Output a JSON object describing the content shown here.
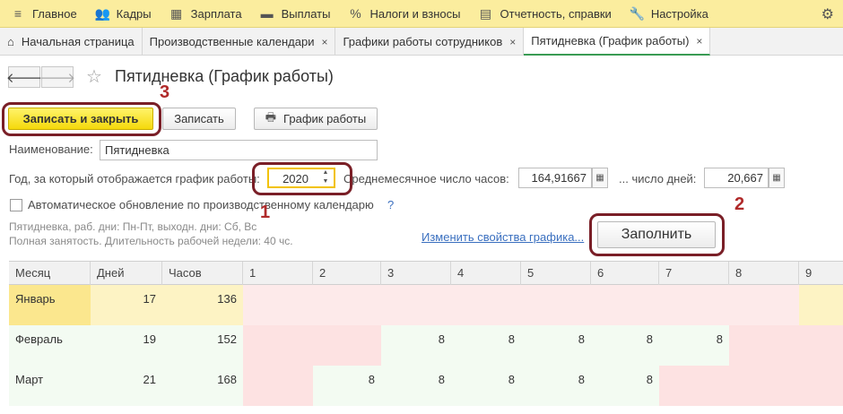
{
  "menu": [
    {
      "icon": "≡",
      "label": "Главное",
      "name": "menu-main"
    },
    {
      "icon": "👥",
      "label": "Кадры",
      "name": "menu-staff"
    },
    {
      "icon": "▦",
      "label": "Зарплата",
      "name": "menu-salary"
    },
    {
      "icon": "▬",
      "label": "Выплаты",
      "name": "menu-payments"
    },
    {
      "icon": "%",
      "label": "Налоги и взносы",
      "name": "menu-taxes"
    },
    {
      "icon": "▤",
      "label": "Отчетность, справки",
      "name": "menu-reports"
    },
    {
      "icon": "🔧",
      "label": "Настройка",
      "name": "menu-settings"
    }
  ],
  "tabs": [
    {
      "label": "Начальная страница",
      "home": true,
      "close": false,
      "active": false
    },
    {
      "label": "Производственные календари",
      "home": false,
      "close": true,
      "active": false
    },
    {
      "label": "Графики работы сотрудников",
      "home": false,
      "close": true,
      "active": false
    },
    {
      "label": "Пятидневка (График работы)",
      "home": false,
      "close": true,
      "active": true
    }
  ],
  "header": {
    "back": "🡐",
    "forward": "🡒",
    "title": "Пятидневка (График работы)"
  },
  "toolbar": {
    "save_close": "Записать и закрыть",
    "save": "Записать",
    "schedule": "График работы"
  },
  "form": {
    "name_label": "Наименование:",
    "name_value": "Пятидневка",
    "year_label": "Год, за который отображается график работы:",
    "year_value": "2020",
    "avg_hours_label": "Среднемесячное число часов:",
    "avg_hours_value": "164,91667",
    "days_label": "... число дней:",
    "days_value": "20,667",
    "auto_update_label": "Автоматическое обновление по производственному календарю",
    "help": "?",
    "info_line1": "Пятидневка, раб. дни: Пн-Пт, выходн. дни: Сб, Вс",
    "info_line2": "Полная занятость. Длительность рабочей недели: 40 чс.",
    "change_link": "Изменить свойства графика...",
    "fill_button": "Заполнить"
  },
  "annotations": {
    "a1": "1",
    "a2": "2",
    "a3": "3"
  },
  "colors": {
    "annotation_ring": "#7a1f27",
    "annotation_digit": "#b02a2a",
    "holiday": "#fde2e2",
    "workday": "#f3fbf2",
    "selected": "#fbe78e"
  },
  "grid": {
    "headers": [
      "Месяц",
      "Дней",
      "Часов",
      "1",
      "2",
      "3",
      "4",
      "5",
      "6",
      "7",
      "8",
      "9"
    ],
    "rows": [
      {
        "month": "Январь",
        "days": "17",
        "hours": "136",
        "cells": [
          "",
          "",
          "",
          "",
          "",
          "",
          "",
          "",
          ""
        ]
      },
      {
        "month": "Февраль",
        "days": "19",
        "hours": "152",
        "cells": [
          "",
          "",
          "8",
          "8",
          "8",
          "8",
          "8",
          "",
          ""
        ]
      },
      {
        "month": "Март",
        "days": "21",
        "hours": "168",
        "cells": [
          "",
          "8",
          "8",
          "8",
          "8",
          "8",
          "",
          "",
          ""
        ]
      }
    ]
  }
}
